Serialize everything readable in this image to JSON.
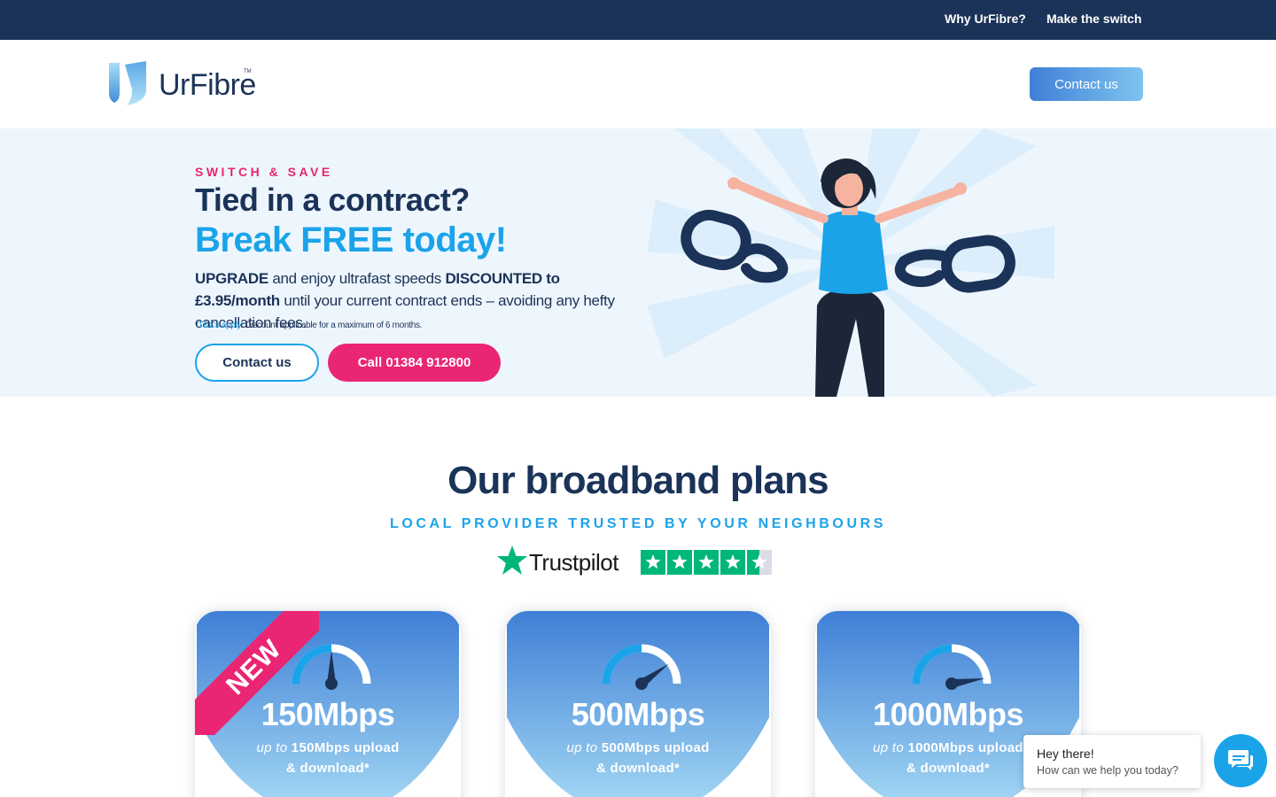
{
  "topbar": {
    "links": [
      {
        "label": "Why UrFibre?"
      },
      {
        "label": "Make the switch"
      }
    ]
  },
  "header": {
    "logo_text": "UrFibre",
    "logo_tm": "TM",
    "contact_label": "Contact us"
  },
  "hero": {
    "kicker": "SWITCH & SAVE",
    "title_line1": "Tied in a contract?",
    "title_line2": "Break FREE today!",
    "body_upgrade": "UPGRADE",
    "body_mid": " and enjoy ultrafast speeds ",
    "body_discount": "DISCOUNTED to £3.95/month",
    "body_rest": " until your current contract ends – avoiding any hefty cancellation fees.",
    "small_prefix": "*",
    "small_link": "T&Cs apply",
    "small_rest": ". Discount applicable for a maximum of 6 months.",
    "btn_contact": "Contact us",
    "btn_call": "Call 01384 912800"
  },
  "plans": {
    "title": "Our broadband plans",
    "subtitle": "LOCAL PROVIDER TRUSTED BY YOUR NEIGHBOURS",
    "trustpilot_label": "Trustpilot",
    "trustpilot_stars": 4.5,
    "cards": [
      {
        "speed": "150Mbps",
        "upto": "up to",
        "line1": " 150Mbps upload",
        "line2": "& download*",
        "badge": "NEW",
        "gauge_level": 0.5
      },
      {
        "speed": "500Mbps",
        "upto": "up to",
        "line1": " 500Mbps upload",
        "line2": "& download*",
        "badge": "",
        "gauge_level": 0.8
      },
      {
        "speed": "1000Mbps",
        "upto": "up to",
        "line1": " 1000Mbps upload",
        "line2": "& download*",
        "badge": "",
        "gauge_level": 0.95
      }
    ]
  },
  "chat": {
    "heading": "Hey there!",
    "message": "How can we help you today?"
  },
  "colors": {
    "navy": "#1b3358",
    "accent_blue": "#1ba3ea",
    "pink": "#ea2574",
    "trustpilot_green": "#00b67a"
  },
  "icons": [
    "urfibre-logo-icon",
    "broken-chain-icon",
    "trustpilot-star-icon",
    "speedometer-icon",
    "chat-icon"
  ]
}
